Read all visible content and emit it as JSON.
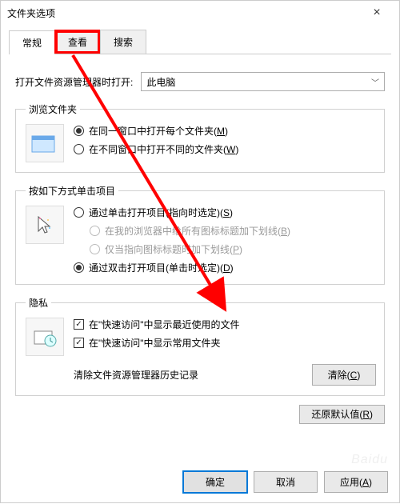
{
  "window": {
    "title": "文件夹选项"
  },
  "tabs": {
    "general": "常规",
    "view": "查看",
    "search": "搜索"
  },
  "openin": {
    "label": "打开文件资源管理器时打开:",
    "value": "此电脑"
  },
  "browse": {
    "legend": "浏览文件夹",
    "same_window": "在同一窗口中打开每个文件夹",
    "same_window_m": "M",
    "own_window": "在不同窗口中打开不同的文件夹",
    "own_window_m": "W"
  },
  "click": {
    "legend": "按如下方式单击项目",
    "single": "通过单击打开项目(指向时选定)",
    "single_m": "S",
    "underline_browser": "在我的浏览器中给所有图标标题加下划线",
    "underline_browser_m": "B",
    "underline_point": "仅当指向图标标题时加下划线",
    "underline_point_m": "P",
    "double": "通过双击打开项目(单击时选定)",
    "double_m": "D"
  },
  "privacy": {
    "legend": "隐私",
    "recent_files": "在\"快速访问\"中显示最近使用的文件",
    "freq_folders": "在\"快速访问\"中显示常用文件夹",
    "clear_label": "清除文件资源管理器历史记录",
    "clear_btn": "清除",
    "clear_btn_m": "C"
  },
  "defaults": {
    "label": "还原默认值",
    "m": "R"
  },
  "buttons": {
    "ok": "确定",
    "cancel": "取消",
    "apply": "应用",
    "apply_m": "A"
  },
  "watermark": "Baidu"
}
